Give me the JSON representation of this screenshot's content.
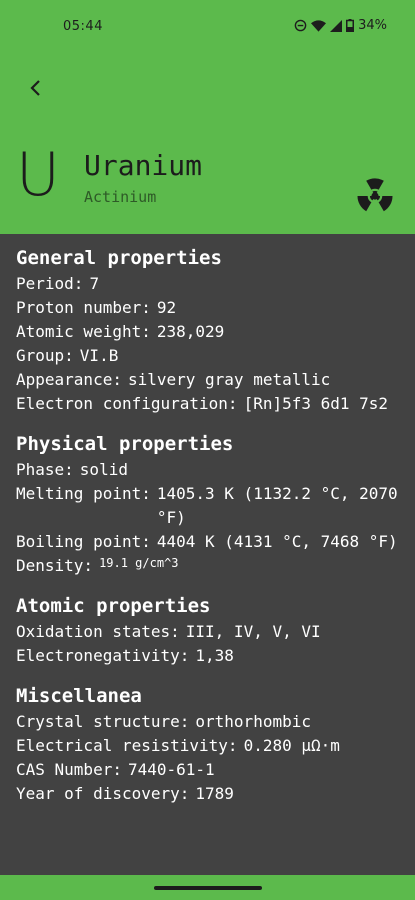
{
  "status": {
    "time": "05:44",
    "battery": "34%"
  },
  "element": {
    "symbol": "U",
    "name": "Uranium",
    "category": "Actinium"
  },
  "colors": {
    "header": "#5cba4c",
    "background": "#424242"
  },
  "sections": [
    {
      "title": "General properties",
      "rows": [
        {
          "label": "Period:",
          "value": "7"
        },
        {
          "label": "Proton number:",
          "value": "92"
        },
        {
          "label": "Atomic weight:",
          "value": "238,029"
        },
        {
          "label": "Group:",
          "value": "VI.B"
        },
        {
          "label": "Appearance:",
          "value": "silvery gray metallic"
        },
        {
          "label": "Electron configuration:",
          "value": "[Rn]5f3 6d1 7s2"
        }
      ]
    },
    {
      "title": "Physical properties",
      "rows": [
        {
          "label": "Phase:",
          "value": "solid"
        },
        {
          "label": "Melting point:",
          "value": "1405.3 K (1132.2 °C, 2070 °F)"
        },
        {
          "label": "Boiling point:",
          "value": "4404 K (4131 °C, 7468 °F)"
        },
        {
          "label": "Density:",
          "value": "19.1 g/cm^3"
        }
      ]
    },
    {
      "title": "Atomic properties",
      "rows": [
        {
          "label": "Oxidation states:",
          "value": "III, IV, V, VI"
        },
        {
          "label": "Electronegativity:",
          "value": "1,38"
        }
      ]
    },
    {
      "title": "Miscellanea",
      "rows": [
        {
          "label": "Crystal structure:",
          "value": "orthorhombic"
        },
        {
          "label": "Electrical resistivity:",
          "value": "0.280 µΩ·m"
        },
        {
          "label": "CAS Number:",
          "value": "7440-61-1"
        },
        {
          "label": "Year of discovery:",
          "value": "1789"
        }
      ]
    }
  ]
}
